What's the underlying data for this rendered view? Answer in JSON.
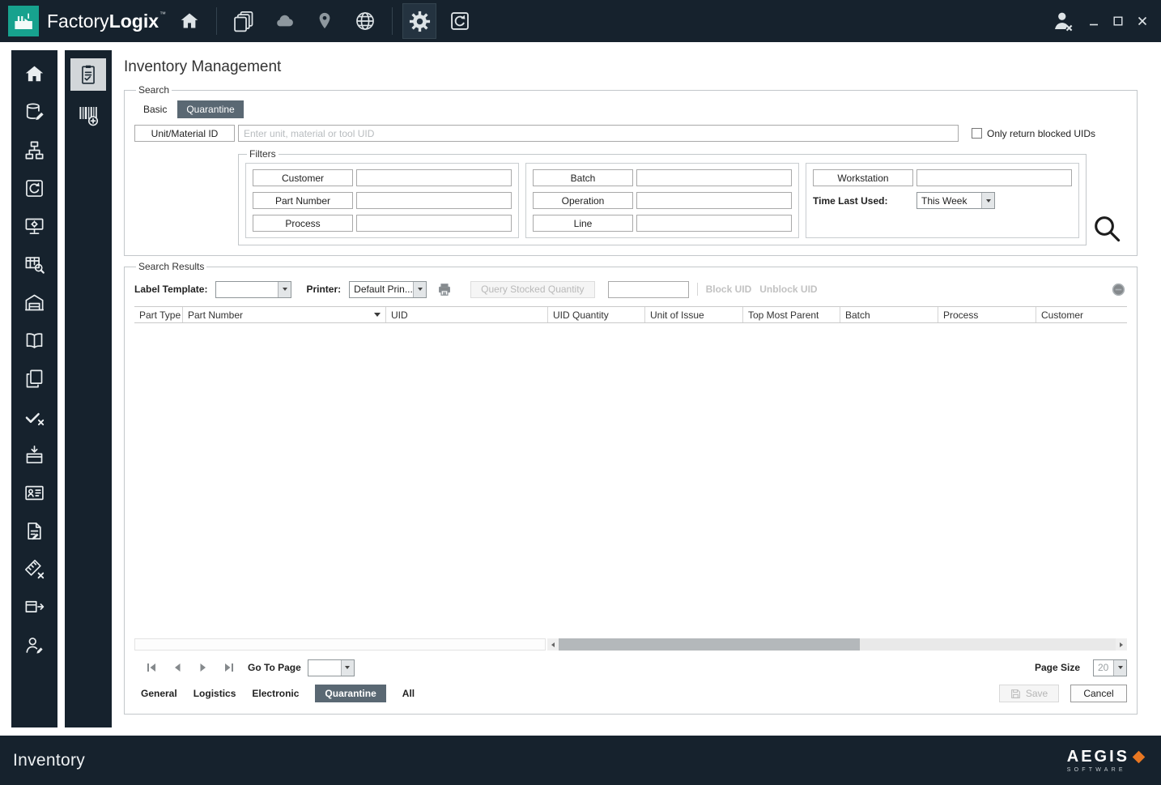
{
  "titlebar": {
    "brand_factory": "Factory",
    "brand_logix": "Logix",
    "brand_tm": "™"
  },
  "page": {
    "title": "Inventory Management"
  },
  "search": {
    "group_label": "Search",
    "tabs": [
      {
        "label": "Basic"
      },
      {
        "label": "Quarantine",
        "active": true
      }
    ],
    "unit_button_label": "Unit/Material ID",
    "unit_placeholder": "Enter unit, material or tool UID",
    "unit_value": "",
    "blocked_checkbox_label": "Only return blocked UIDs",
    "blocked_checkbox_checked": false,
    "filters": {
      "group_label": "Filters",
      "col1": [
        "Customer",
        "Part Number",
        "Process"
      ],
      "col2": [
        "Batch",
        "Operation",
        "Line"
      ],
      "workstation_label": "Workstation",
      "time_label": "Time Last Used:",
      "time_value": "This Week"
    }
  },
  "results": {
    "group_label": "Search Results",
    "label_template_label": "Label Template:",
    "label_template_value": "",
    "printer_label": "Printer:",
    "printer_value": "Default Prin...",
    "query_button_label": "Query Stocked Quantity",
    "query_quantity_value": "",
    "block_uid_label": "Block UID",
    "unblock_uid_label": "Unblock UID",
    "columns": [
      "Part Type",
      "Part Number",
      "UID",
      "UID Quantity",
      "Unit of Issue",
      "Top Most Parent",
      "Batch",
      "Process",
      "Customer"
    ],
    "rows": [],
    "go_to_page_label": "Go To Page",
    "go_to_page_value": "",
    "page_size_label": "Page Size",
    "page_size_value": "20",
    "bottom_tabs": [
      "General",
      "Logistics",
      "Electronic",
      "Quarantine",
      "All"
    ],
    "active_bottom_tab": "Quarantine",
    "save_label": "Save",
    "cancel_label": "Cancel"
  },
  "statusbar": {
    "title": "Inventory",
    "brand": "AEGIS",
    "brand_sub": "SOFTWARE"
  },
  "icons": {
    "titlebar": [
      "factorylogix-logo",
      "home-icon",
      "documents-icon",
      "cloud-icon",
      "location-icon",
      "globe-icon",
      "settings-gear-icon",
      "history-icon",
      "user-signout-icon",
      "minimize-icon",
      "maximize-icon",
      "close-icon"
    ],
    "sidebar_primary": [
      "home-icon",
      "database-edit-icon",
      "routing-icon",
      "history-icon",
      "workstation-icon",
      "grid-search-icon",
      "warehouse-icon",
      "book-icon",
      "pages-icon",
      "verify-icon",
      "receive-icon",
      "id-card-icon",
      "document-edit-icon",
      "measure-icon",
      "ship-icon",
      "user-question-icon"
    ],
    "sidebar_secondary": [
      "inspection-plan-icon",
      "barcode-add-icon"
    ],
    "results_toolbar": [
      "printer-icon",
      "block-circle-icon",
      "search-icon",
      "sort-desc-icon"
    ]
  },
  "colors": {
    "navy": "#16222d",
    "teal": "#17a28e",
    "active_tab_bg": "#5a6873",
    "aegis_orange": "#e87722"
  }
}
